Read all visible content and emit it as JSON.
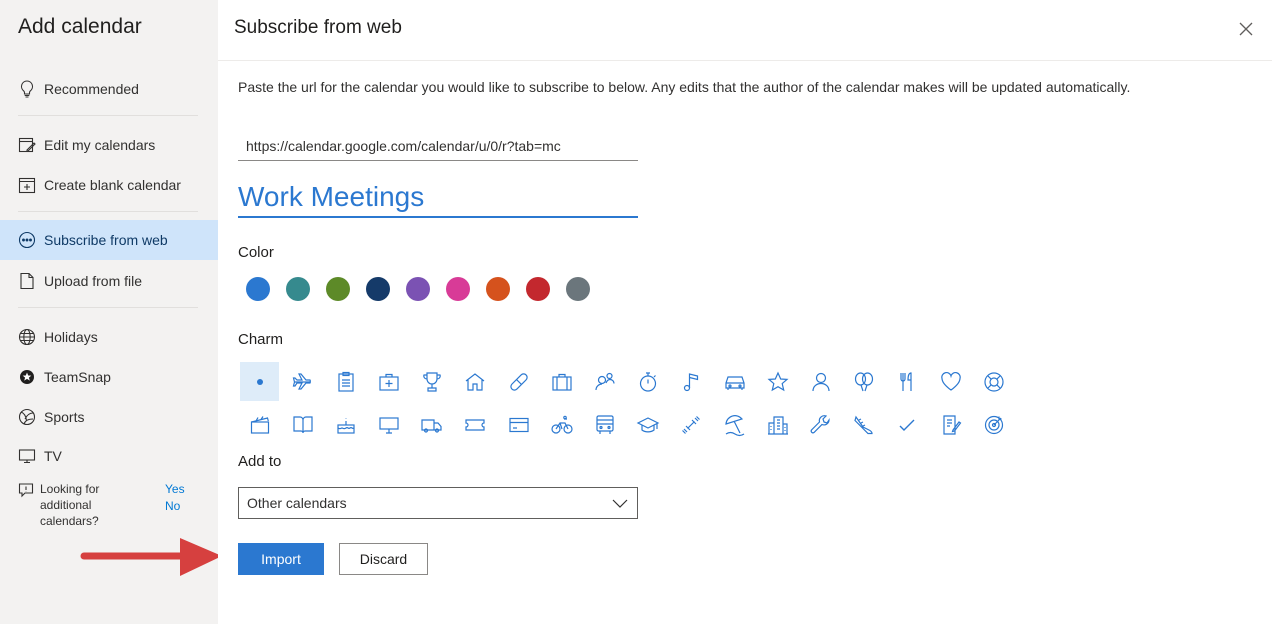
{
  "sidebar": {
    "title": "Add calendar",
    "items": [
      {
        "label": "Recommended",
        "icon": "lightbulb-icon"
      },
      {
        "label": "Edit my calendars",
        "icon": "edit-calendar-icon"
      },
      {
        "label": "Create blank calendar",
        "icon": "add-calendar-icon"
      },
      {
        "label": "Subscribe from web",
        "icon": "subscribe-icon",
        "active": true
      },
      {
        "label": "Upload from file",
        "icon": "file-icon"
      },
      {
        "label": "Holidays",
        "icon": "globe-icon"
      },
      {
        "label": "TeamSnap",
        "icon": "teamsnap-icon"
      },
      {
        "label": "Sports",
        "icon": "sports-ball-icon"
      },
      {
        "label": "TV",
        "icon": "tv-icon"
      }
    ],
    "looking": {
      "text": "Looking for additional calendars?",
      "yes": "Yes",
      "no": "No"
    }
  },
  "main": {
    "title": "Subscribe from web",
    "description": "Paste the url for the calendar you would like to subscribe to below. Any edits that the author of the calendar makes will be updated automatically.",
    "url_value": "https://calendar.google.com/calendar/u/0/r?tab=mc",
    "name_value": "Work Meetings",
    "color_label": "Color",
    "colors": [
      "#2b78d0",
      "#368a8e",
      "#5d8a28",
      "#153a69",
      "#7b52b3",
      "#d83b97",
      "#d5521d",
      "#c3282e",
      "#6b767c"
    ],
    "charm_label": "Charm",
    "add_to_label": "Add to",
    "add_to_value": "Other calendars",
    "import_label": "Import",
    "discard_label": "Discard",
    "accent_color": "#2b78d0",
    "annotation_arrow_color": "#d6403f"
  }
}
